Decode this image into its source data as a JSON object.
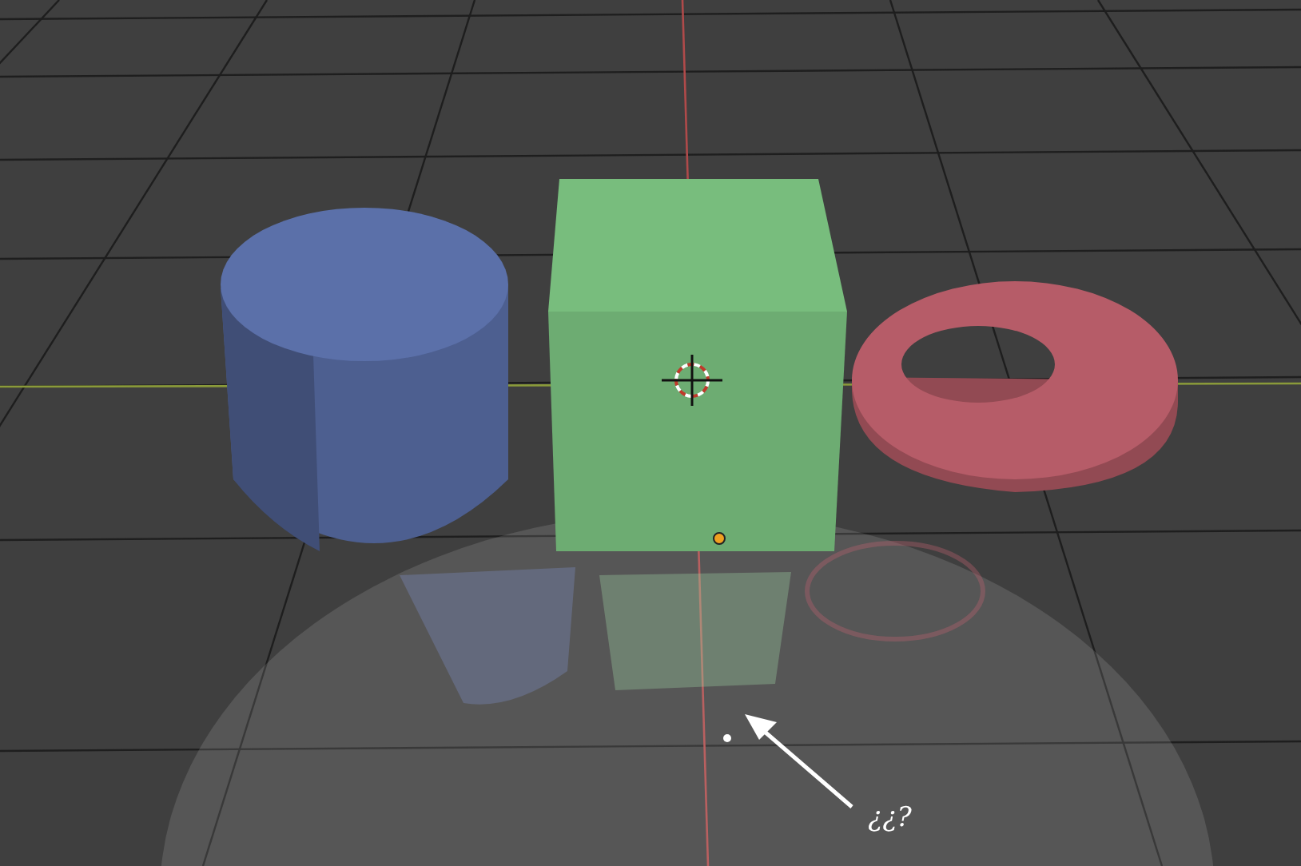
{
  "viewport": {
    "objects": [
      {
        "kind": "cylinder",
        "color": "#5b70a9"
      },
      {
        "kind": "cube",
        "color": "#6dac72"
      },
      {
        "kind": "torus",
        "color": "#b65c68"
      }
    ],
    "annotation": {
      "text": "¿¿?"
    }
  }
}
